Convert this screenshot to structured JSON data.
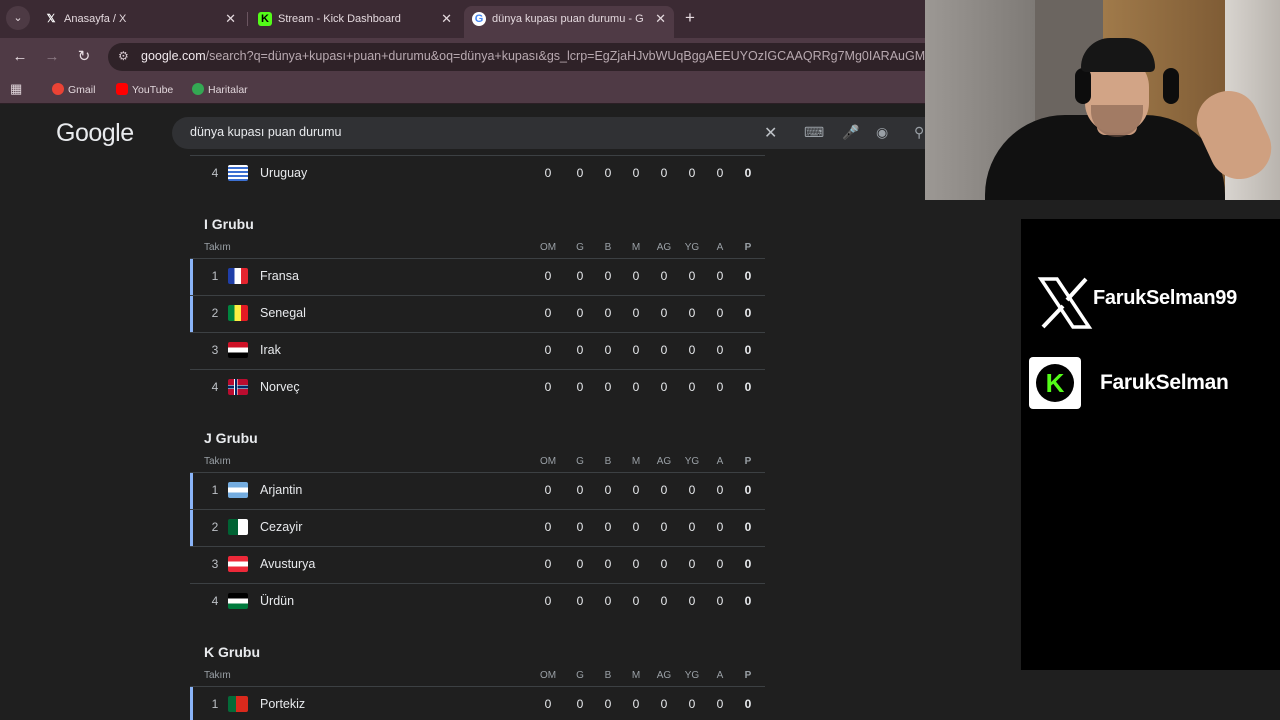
{
  "tabs": [
    {
      "favicon": "x-logo-icon",
      "label": "Anasayfa / X",
      "active": false
    },
    {
      "favicon": "kick-logo-icon",
      "label": "Stream - Kick Dashboard",
      "active": false
    },
    {
      "favicon": "google-logo-icon",
      "label": "dünya kupası puan durumu - G",
      "active": true
    }
  ],
  "address_bar": {
    "domain": "google.com",
    "path": "/search?q=dünya+kupası+puan+durumu&oq=dünya+kupası&gs_lcrp=EgZjaHJvbWUqBggAEEUYOzIGCAAQRRg7Mg0IARAuGM"
  },
  "bookmarks": [
    {
      "label": "Gmail",
      "icon": "gmail-icon",
      "color": "#ea4335"
    },
    {
      "label": "YouTube",
      "icon": "youtube-icon",
      "color": "#ff0000"
    },
    {
      "label": "Haritalar",
      "icon": "maps-icon",
      "color": "#34a853"
    }
  ],
  "google": {
    "logo": "Google",
    "query": "dünya kupası puan durumu"
  },
  "columns": [
    "OM",
    "G",
    "B",
    "M",
    "AG",
    "YG",
    "A",
    "P"
  ],
  "team_header": "Takım",
  "groups": [
    {
      "title": "",
      "teams": [
        {
          "pos": "4",
          "name": "Uruguay",
          "flag": "uruguay",
          "qual": false,
          "stats": [
            "0",
            "0",
            "0",
            "0",
            "0",
            "0",
            "0",
            "0"
          ]
        }
      ]
    },
    {
      "title": "I Grubu",
      "teams": [
        {
          "pos": "1",
          "name": "Fransa",
          "flag": "france",
          "qual": true,
          "stats": [
            "0",
            "0",
            "0",
            "0",
            "0",
            "0",
            "0",
            "0"
          ]
        },
        {
          "pos": "2",
          "name": "Senegal",
          "flag": "senegal",
          "qual": true,
          "stats": [
            "0",
            "0",
            "0",
            "0",
            "0",
            "0",
            "0",
            "0"
          ]
        },
        {
          "pos": "3",
          "name": "Irak",
          "flag": "iraq",
          "qual": false,
          "stats": [
            "0",
            "0",
            "0",
            "0",
            "0",
            "0",
            "0",
            "0"
          ]
        },
        {
          "pos": "4",
          "name": "Norveç",
          "flag": "norway",
          "qual": false,
          "stats": [
            "0",
            "0",
            "0",
            "0",
            "0",
            "0",
            "0",
            "0"
          ]
        }
      ]
    },
    {
      "title": "J Grubu",
      "teams": [
        {
          "pos": "1",
          "name": "Arjantin",
          "flag": "argentina",
          "qual": true,
          "stats": [
            "0",
            "0",
            "0",
            "0",
            "0",
            "0",
            "0",
            "0"
          ]
        },
        {
          "pos": "2",
          "name": "Cezayir",
          "flag": "algeria",
          "qual": true,
          "stats": [
            "0",
            "0",
            "0",
            "0",
            "0",
            "0",
            "0",
            "0"
          ]
        },
        {
          "pos": "3",
          "name": "Avusturya",
          "flag": "austria",
          "qual": false,
          "stats": [
            "0",
            "0",
            "0",
            "0",
            "0",
            "0",
            "0",
            "0"
          ]
        },
        {
          "pos": "4",
          "name": "Ürdün",
          "flag": "jordan",
          "qual": false,
          "stats": [
            "0",
            "0",
            "0",
            "0",
            "0",
            "0",
            "0",
            "0"
          ]
        }
      ]
    },
    {
      "title": "K Grubu",
      "teams": [
        {
          "pos": "1",
          "name": "Portekiz",
          "flag": "portugal",
          "qual": true,
          "stats": [
            "0",
            "0",
            "0",
            "0",
            "0",
            "0",
            "0",
            "0"
          ]
        }
      ]
    }
  ],
  "socials": {
    "x_handle": "FarukSelman99",
    "kick_handle": "FarukSelman"
  }
}
